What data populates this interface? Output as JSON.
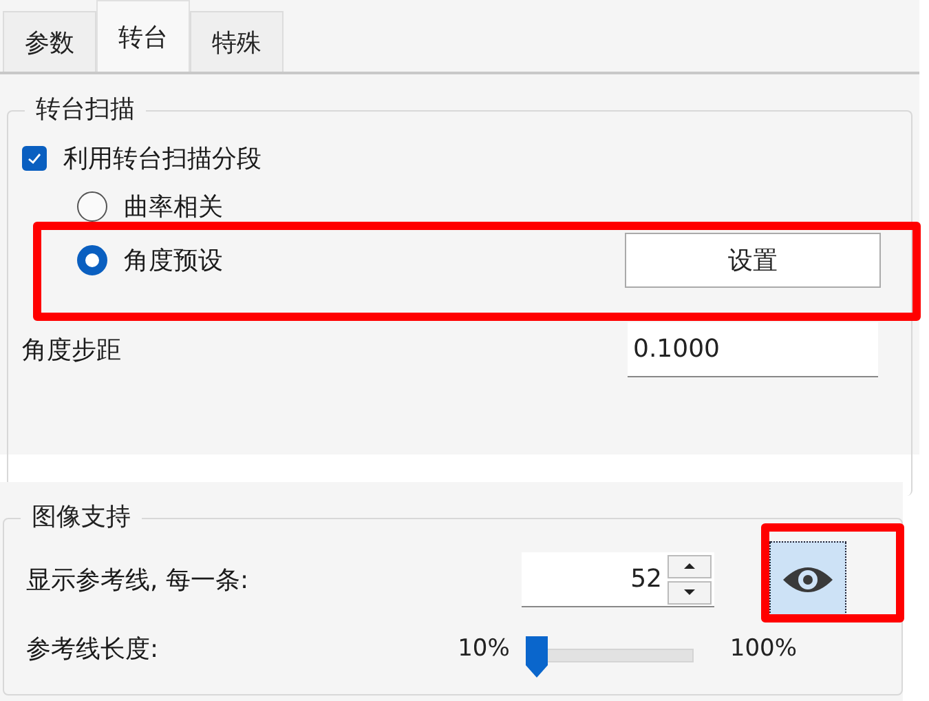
{
  "tabs": [
    {
      "label": "参数",
      "selected": false
    },
    {
      "label": "转台",
      "selected": true
    },
    {
      "label": "特殊",
      "selected": false
    }
  ],
  "turntable_scan": {
    "title": "转台扫描",
    "use_segments": {
      "label": "利用转台扫描分段",
      "checked": true
    },
    "modes": [
      {
        "label": "曲率相关",
        "selected": false
      },
      {
        "label": "角度预设",
        "selected": true,
        "highlighted": true
      }
    ],
    "settings_button": "设置",
    "angle_step": {
      "label": "角度步距",
      "value": "0.1000"
    }
  },
  "image_support": {
    "title": "图像支持",
    "reference_lines": {
      "label": "显示参考线, 每一条:",
      "value": "52"
    },
    "show_toggle": {
      "on": true,
      "highlighted": true
    },
    "line_length": {
      "label": "参考线长度:",
      "min_label": "10%",
      "max_label": "100%",
      "level": 0
    }
  }
}
